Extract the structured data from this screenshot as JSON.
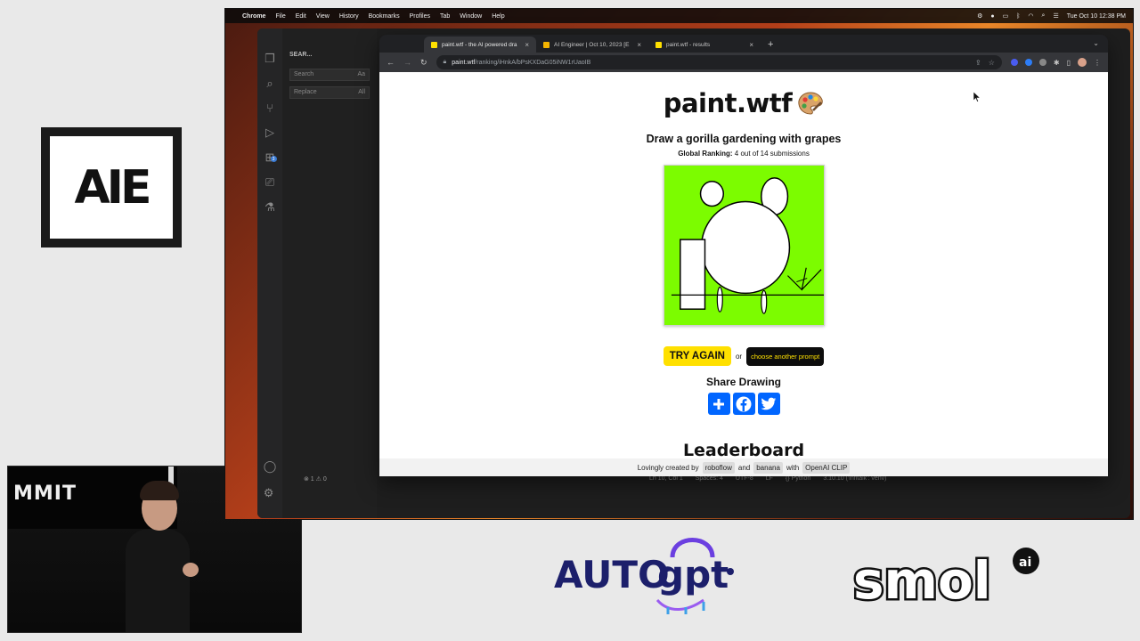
{
  "stage": {
    "logo_text": "AIE",
    "camera_text": "MMIT"
  },
  "menubar": {
    "app_name": "Chrome",
    "items": [
      "File",
      "Edit",
      "View",
      "History",
      "Bookmarks",
      "Profiles",
      "Tab",
      "Window",
      "Help"
    ],
    "clock": "Tue Oct 10  12:38 PM"
  },
  "vscode": {
    "search_title": "SEAR...",
    "search_placeholder": "Search",
    "search_opts": "Aa",
    "replace_placeholder": "Replace",
    "replace_opts": "All",
    "badge": "3",
    "status_left": "⊗ 1   ⚠ 0",
    "status_items": [
      "Ln 10, Col 1",
      "Spaces: 4",
      "UTF-8",
      "LF",
      "{} Python",
      "3.10.10 ('infltalk': venv)"
    ]
  },
  "chrome": {
    "tabs": [
      {
        "title": "paint.wtf - the AI powered dra",
        "favicon_color": "#ffe000",
        "active": true
      },
      {
        "title": "AI Engineer | Oct 10, 2023 [E",
        "favicon_color": "#f4b400",
        "active": false
      },
      {
        "title": "paint.wtf - results",
        "favicon_color": "#ffe000",
        "active": false
      }
    ],
    "url_host": "paint.wtf",
    "url_path": "/ranking/iHnkA/bPsKXDaG05iNW1rUaoIB"
  },
  "page": {
    "site_title": "paint.wtf",
    "prompt": "Draw a gorilla gardening with grapes",
    "ranking_label": "Global Ranking:",
    "ranking_value": "4 out of 14 submissions",
    "try_again": "TRY AGAIN",
    "or": "or",
    "choose_prompt": "choose another prompt",
    "share_title": "Share Drawing",
    "share_buttons": [
      "share-icon",
      "facebook-icon",
      "twitter-icon"
    ],
    "leaderboard_title": "Leaderboard",
    "footer": {
      "created_by": "Lovingly created by",
      "tag1": "roboflow",
      "and": "and",
      "tag2": "banana",
      "with": "with",
      "tag3": "OpenAI CLIP"
    }
  },
  "colors": {
    "canvas_green": "#7cfc00",
    "try_again_bg": "#ffe000",
    "choose_bg": "#0d0d0d",
    "share_blue": "#0166ff"
  }
}
